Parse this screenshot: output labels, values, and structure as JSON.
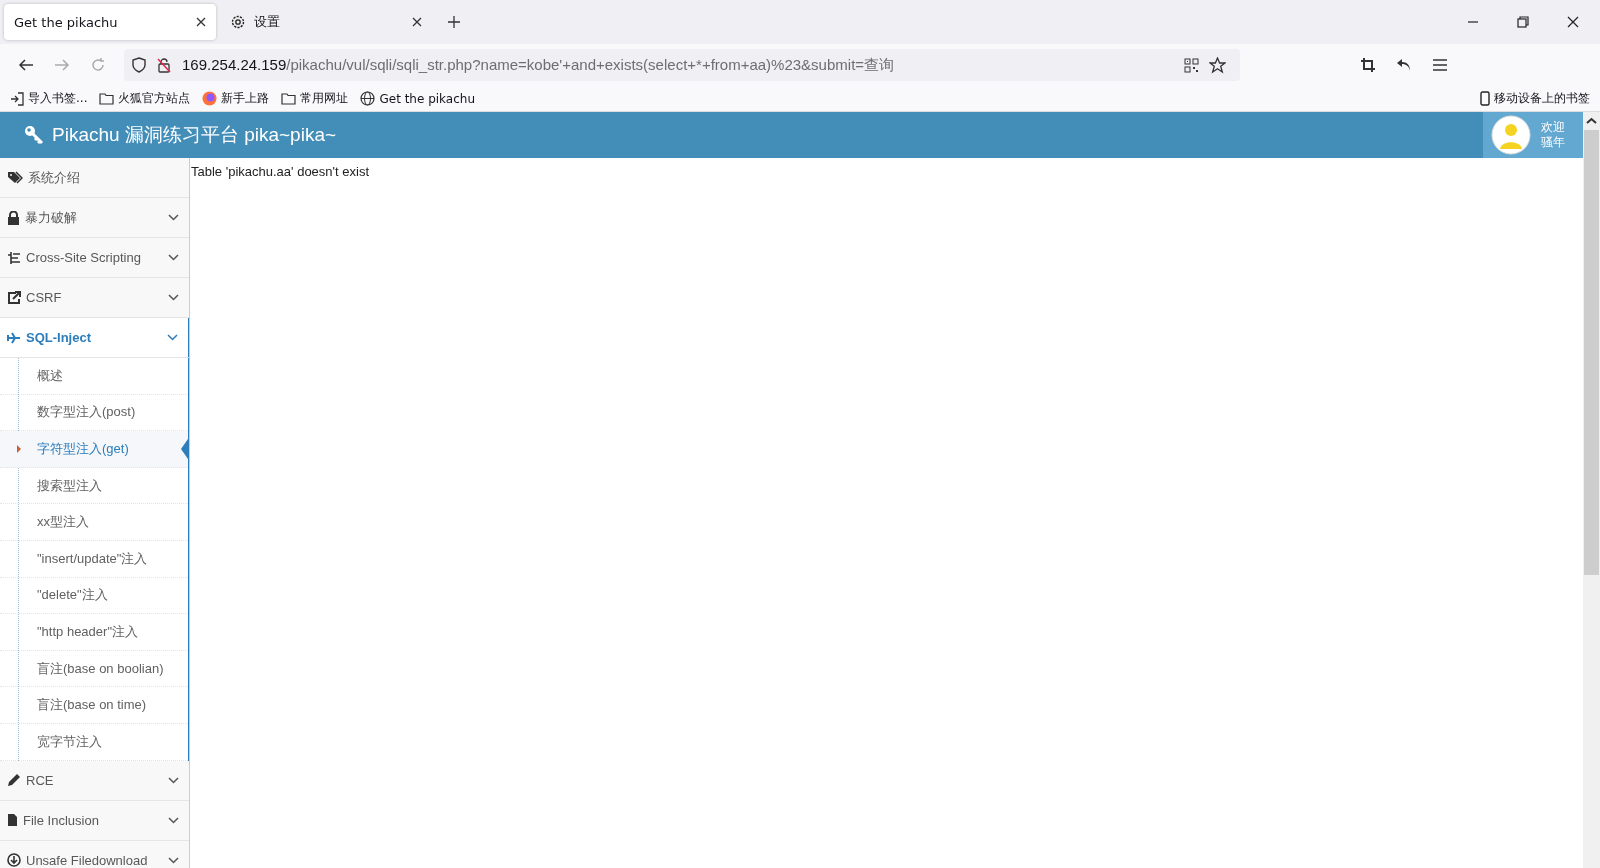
{
  "browser": {
    "tabs": [
      {
        "title": "Get the pikachu",
        "selected": true
      },
      {
        "title": "设置",
        "selected": false
      }
    ],
    "address": {
      "host": "169.254.24.159",
      "path": "/pikachu/vul/sqli/sqli_str.php?name=kobe'+and+exists(select+*+from+aa)%23&submit=查询"
    },
    "bookmarks": [
      "导入书签...",
      "火狐官方站点",
      "新手上路",
      "常用网址",
      "Get the pikachu"
    ],
    "mobile_bookmarks": "移动设备上的书签"
  },
  "header": {
    "title": "Pikachu 漏洞练习平台 pika~pika~",
    "greeting": [
      "欢迎",
      "骚年"
    ]
  },
  "sidebar": [
    {
      "label": "系统介绍",
      "kind": "link"
    },
    {
      "label": "暴力破解",
      "kind": "group",
      "expanded": false
    },
    {
      "label": "Cross-Site Scripting",
      "kind": "group",
      "expanded": false
    },
    {
      "label": "CSRF",
      "kind": "group",
      "expanded": false
    },
    {
      "label": "SQL-Inject",
      "kind": "group",
      "expanded": true,
      "children": [
        {
          "label": "概述",
          "selected": false
        },
        {
          "label": "数字型注入(post)",
          "selected": false
        },
        {
          "label": "字符型注入(get)",
          "selected": true
        },
        {
          "label": "搜索型注入",
          "selected": false
        },
        {
          "label": "xx型注入",
          "selected": false
        },
        {
          "label": "\"insert/update\"注入",
          "selected": false
        },
        {
          "label": "\"delete\"注入",
          "selected": false
        },
        {
          "label": "\"http header\"注入",
          "selected": false
        },
        {
          "label": "盲注(base on boolian)",
          "selected": false
        },
        {
          "label": "盲注(base on time)",
          "selected": false
        },
        {
          "label": "宽字节注入",
          "selected": false
        }
      ]
    },
    {
      "label": "RCE",
      "kind": "group",
      "expanded": false
    },
    {
      "label": "File Inclusion",
      "kind": "group",
      "expanded": false
    },
    {
      "label": "Unsafe Filedownload",
      "kind": "group",
      "expanded": false
    }
  ],
  "content": {
    "message": "Table 'pikachu.aa' doesn't exist"
  }
}
